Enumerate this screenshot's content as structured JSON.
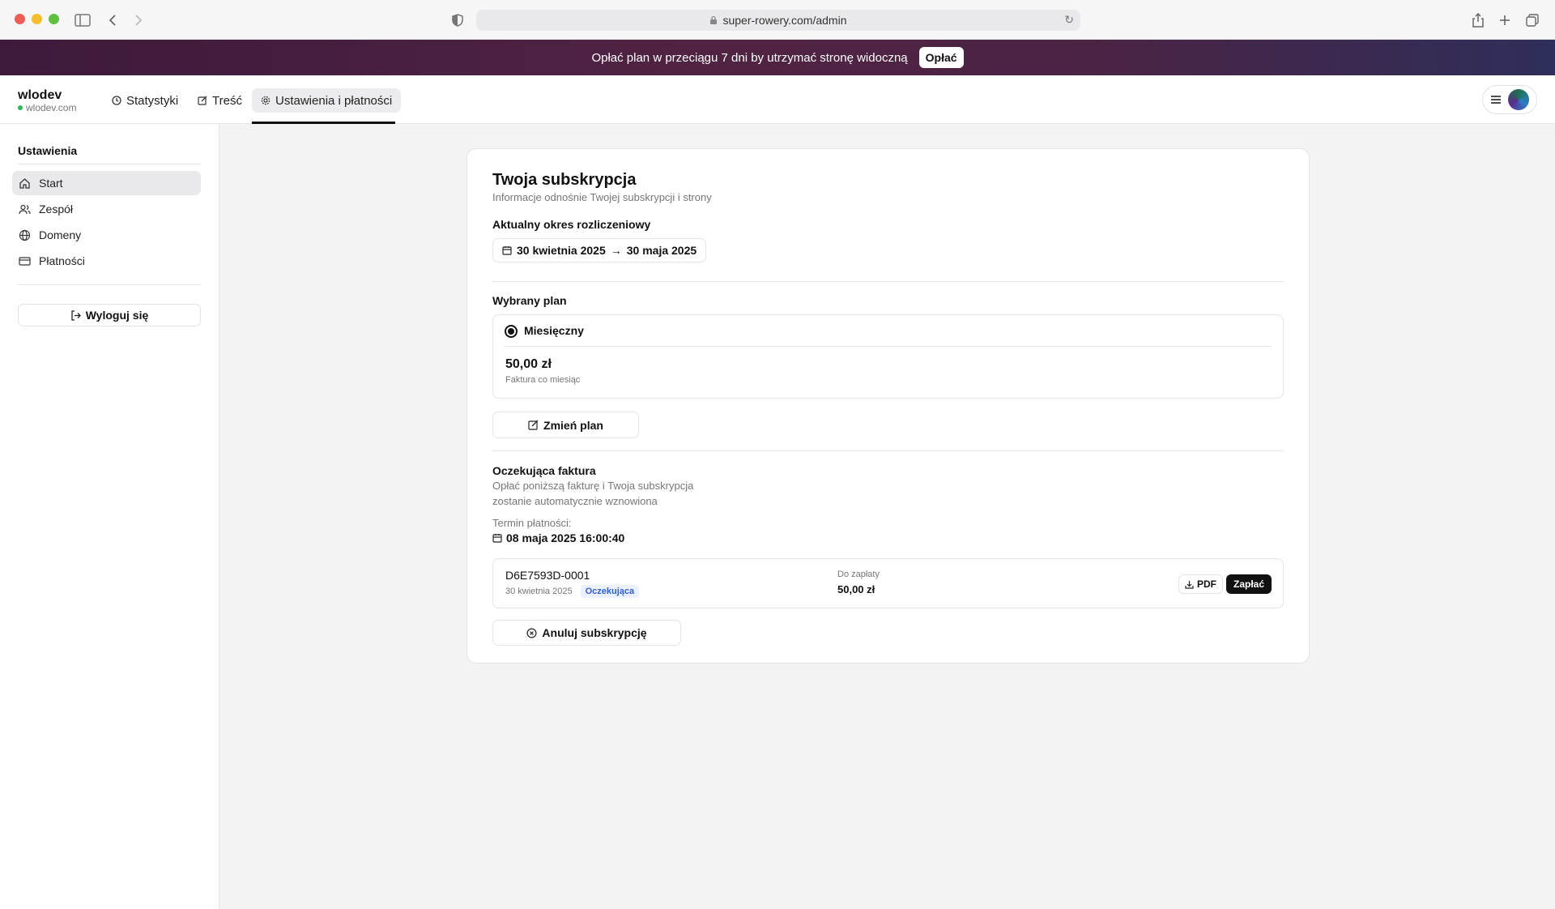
{
  "browser": {
    "url": "super-rowery.com/admin"
  },
  "banner": {
    "text": "Opłać plan w przeciągu 7 dni by utrzymać stronę widoczną",
    "button": "Opłać"
  },
  "site": {
    "name": "wlodev",
    "url": "wlodev.com",
    "status_color": "#2eb85c"
  },
  "tabs": [
    {
      "label": "Statystyki",
      "icon": "clock-icon"
    },
    {
      "label": "Treść",
      "icon": "edit-icon"
    },
    {
      "label": "Ustawienia i płatności",
      "icon": "gear-icon",
      "active": true
    }
  ],
  "sidebar": {
    "heading": "Ustawienia",
    "items": [
      {
        "label": "Start",
        "icon": "home-icon",
        "active": true
      },
      {
        "label": "Zespół",
        "icon": "users-icon"
      },
      {
        "label": "Domeny",
        "icon": "globe-icon"
      },
      {
        "label": "Płatności",
        "icon": "credit-card-icon"
      }
    ],
    "logout": "Wyloguj się"
  },
  "subscription": {
    "title": "Twoja subskrypcja",
    "subtitle": "Informacje odnośnie Twojej subskrypcji i strony",
    "period_label": "Aktualny okres rozliczeniowy",
    "period_start": "30 kwietnia 2025",
    "period_end": "30 maja 2025",
    "plan_label": "Wybrany plan",
    "plan_name": "Miesięczny",
    "plan_price": "50,00 zł",
    "plan_note": "Faktura co miesiąc",
    "change_plan": "Zmień plan",
    "pending_label": "Oczekująca faktura",
    "pending_desc_1": "Opłać poniższą fakturę i Twoja subskrypcja",
    "pending_desc_2": "zostanie automatycznie wznowiona",
    "due_label": "Termin płatności:",
    "due_date": "08 maja 2025 16:00:40",
    "invoice": {
      "id": "D6E7593D-0001",
      "date": "30 kwietnia 2025",
      "status": "Oczekująca",
      "amount_label": "Do zapłaty",
      "amount": "50,00 zł",
      "pdf": "PDF",
      "pay": "Zapłać"
    },
    "cancel": "Anuluj subskrypcję"
  }
}
